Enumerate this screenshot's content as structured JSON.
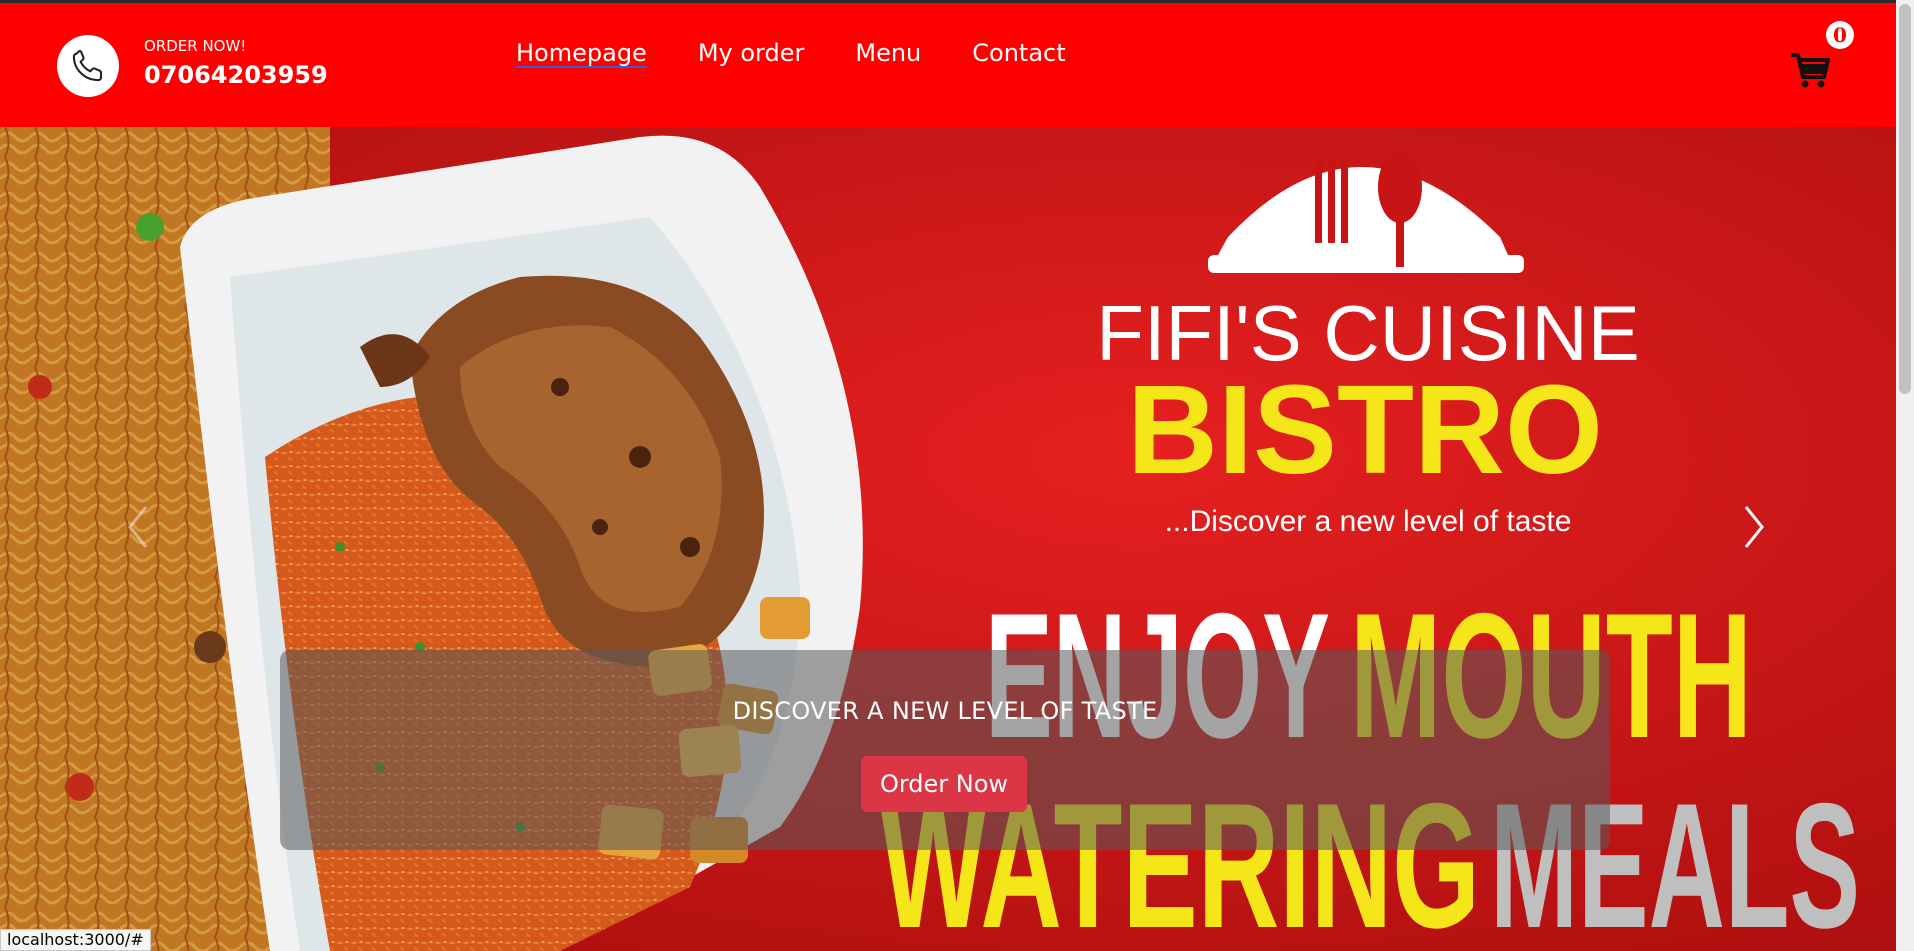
{
  "header": {
    "order_label": "ORDER NOW!",
    "phone": "07064203959",
    "phone_icon": "phone-icon"
  },
  "nav": {
    "items": [
      {
        "label": "Homepage",
        "active": true
      },
      {
        "label": "My order",
        "active": false
      },
      {
        "label": "Menu",
        "active": false
      },
      {
        "label": "Contact",
        "active": false
      }
    ]
  },
  "cart": {
    "count": "0",
    "icon": "cart-icon"
  },
  "hero": {
    "banner": {
      "brand_line1": "FIFI'S CUISINE",
      "brand_line2": "BISTRO",
      "tagline": "...Discover a new level of taste",
      "headline_white1": "ENJOY",
      "headline_yellow1": "MOUTH",
      "headline_yellow2": "WATERING",
      "headline_grey": "MEALS"
    },
    "caption": "DISCOVER A NEW LEVEL OF TASTE",
    "button_label": "Order Now",
    "prev_icon": "chevron-left-icon",
    "next_icon": "chevron-right-icon"
  },
  "status_bar": {
    "url": "localhost:3000/#"
  },
  "colors": {
    "brand_red": "#ff0000",
    "button_red": "#dc3545",
    "yellow": "#f5e61a"
  }
}
